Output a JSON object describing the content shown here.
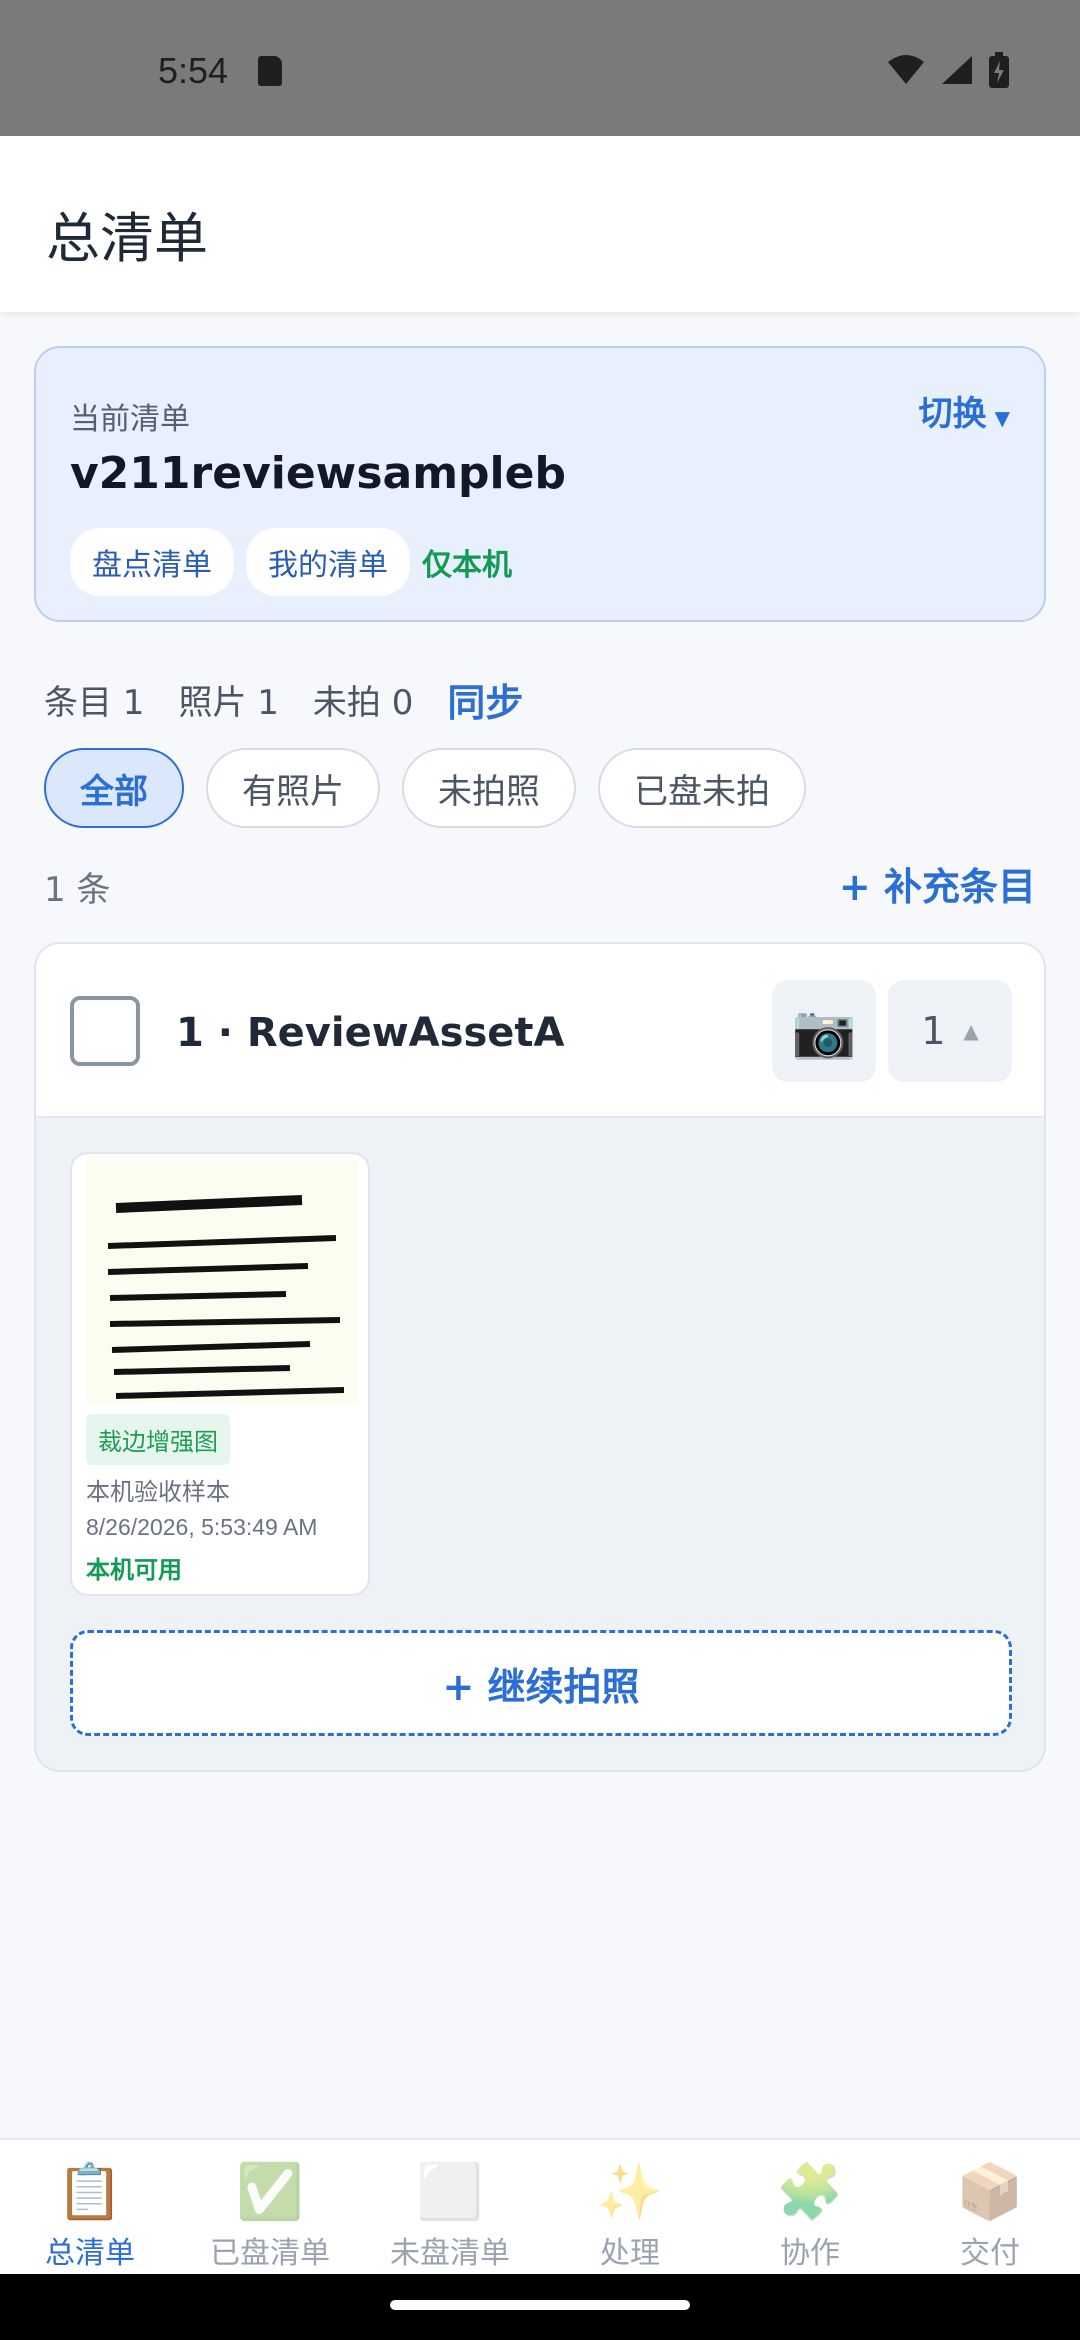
{
  "status_bar": {
    "time": "5:54"
  },
  "header": {
    "title": "总清单"
  },
  "current_list": {
    "label": "当前清单",
    "switch_label": "切换",
    "switch_arrow": "▼",
    "name": "v211reviewsampleb",
    "tags": [
      "盘点清单",
      "我的清单"
    ],
    "scope": "仅本机"
  },
  "stats": {
    "items": "条目 1",
    "photos": "照片 1",
    "unshot": "未拍 0",
    "sync_label": "同步"
  },
  "filters": [
    "全部",
    "有照片",
    "未拍照",
    "已盘未拍"
  ],
  "active_filter": "全部",
  "list": {
    "count": "1 条",
    "add_label": "+ 补充条目"
  },
  "item": {
    "title": "1 · ReviewAssetA",
    "camera_icon": "📷",
    "quantity": "1",
    "quantity_arrow": "▲",
    "photo": {
      "badge": "裁边增强图",
      "note": "本机验收样本",
      "timestamp": "8/26/2026, 5:53:49 AM",
      "status": "本机可用"
    },
    "continue_label": "+ 继续拍照"
  },
  "nav": [
    {
      "icon": "📋",
      "label": "总清单"
    },
    {
      "icon": "✅",
      "label": "已盘清单"
    },
    {
      "icon": "⬜",
      "label": "未盘清单"
    },
    {
      "icon": "✨",
      "label": "处理"
    },
    {
      "icon": "🧩",
      "label": "协作"
    },
    {
      "icon": "📦",
      "label": "交付"
    }
  ],
  "colors": {
    "accent": "#2b6ed6",
    "success": "#139a55",
    "card_bg": "#e8f0fe"
  }
}
